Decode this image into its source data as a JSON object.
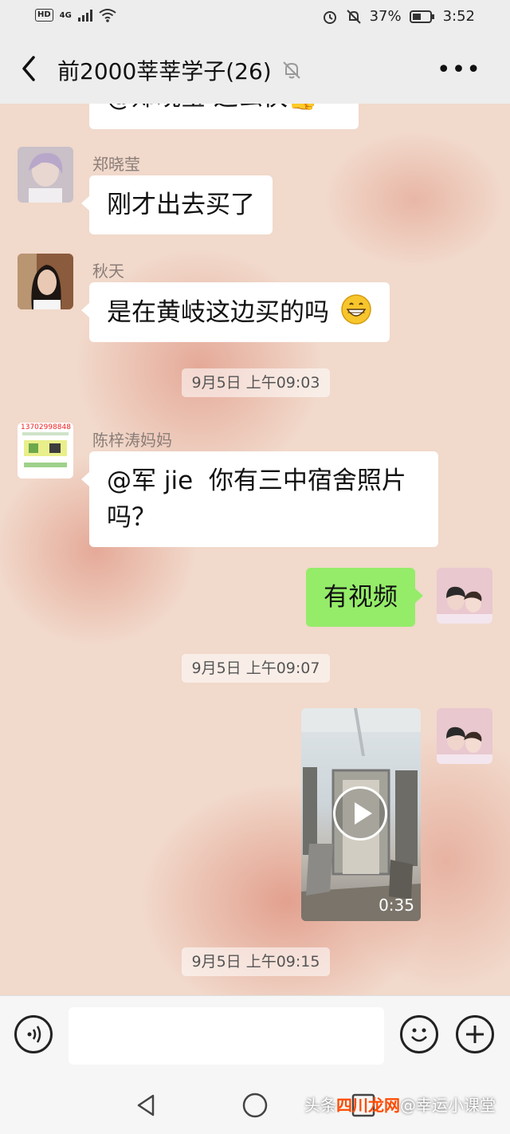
{
  "status_bar": {
    "network_badge": "HD",
    "network_type": "4G",
    "battery": "37%",
    "time": "3:52",
    "icons": [
      "hd-icon",
      "signal-icon",
      "wifi-icon",
      "alarm-icon",
      "mute-notification-icon",
      "battery-icon"
    ]
  },
  "header": {
    "title": "前2000莘莘学子(26)",
    "muted": true
  },
  "messages": [
    {
      "sender": "",
      "text": "@郑晓莹 这么快👍",
      "partial": true
    },
    {
      "sender": "郑晓莹",
      "text": "刚才出去买了"
    },
    {
      "sender": "秋天",
      "text": "是在黄岐这边买的吗",
      "emoji": "grinning-emoji"
    },
    {
      "timestamp": "9月5日 上午09:03"
    },
    {
      "sender": "陈梓涛妈妈",
      "avatar_text": "13702998848",
      "text_line1": "@军 jie  你有三中宿舍照片",
      "text_line2": "吗？"
    },
    {
      "sender": "me",
      "text": "有视频"
    },
    {
      "timestamp": "9月5日 上午09:07"
    },
    {
      "sender": "me",
      "type": "video",
      "duration": "0:35"
    },
    {
      "timestamp": "9月5日 上午09:15"
    }
  ],
  "input": {
    "placeholder": ""
  },
  "watermark": {
    "prefix": "头条",
    "brand": "四川龙网",
    "suffix": "@幸运小课堂"
  },
  "colors": {
    "self_bubble": "#95ec69",
    "other_bubble": "#ffffff",
    "header_bg": "#ededed"
  }
}
